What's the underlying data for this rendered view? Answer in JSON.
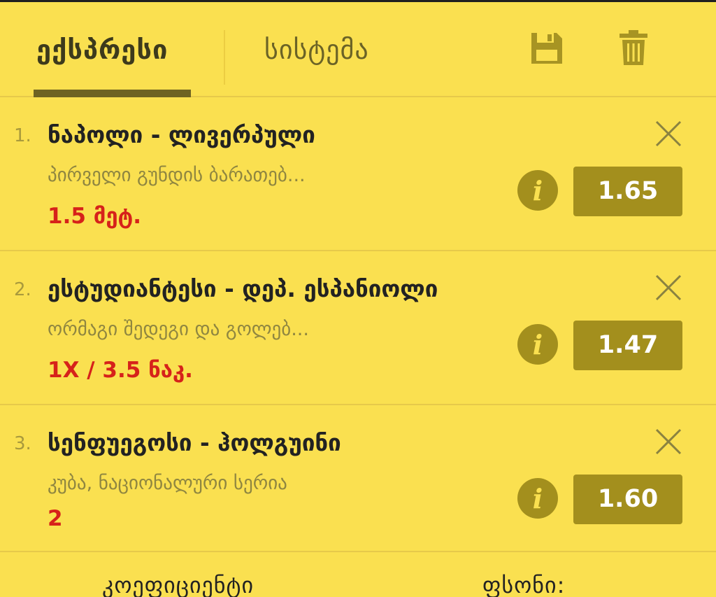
{
  "header": {
    "tabs": [
      {
        "label": "ექსპრესი",
        "active": true
      },
      {
        "label": "სისტემა",
        "active": false
      }
    ],
    "icons": [
      "save-icon",
      "trash-icon"
    ]
  },
  "bets": [
    {
      "index": "1.",
      "match": "ნაპოლი - ლივერპული",
      "market": "პირველი გუნდის ბარათებ...",
      "selection": "1.5 მეტ.",
      "odds": "1.65"
    },
    {
      "index": "2.",
      "match": "ესტუდიანტესი - დეპ. ესპანიოლი",
      "market": "ორმაგი შედეგი და გოლებ...",
      "selection": "1X / 3.5 ნაკ.",
      "odds": "1.47"
    },
    {
      "index": "3.",
      "match": "სენფუეგოსი - ჰოლგუინი",
      "market": "კუბა, ნაციონალური სერია",
      "selection": "2",
      "odds": "1.60"
    }
  ],
  "footer": {
    "coefficient_label": "კოეფიციენტი",
    "money_label": "ფსონი:"
  },
  "colors": {
    "background": "#fae050",
    "odds_button": "#a38f1d",
    "selection_text": "#d6221a",
    "tab_underline": "#6e6322"
  }
}
